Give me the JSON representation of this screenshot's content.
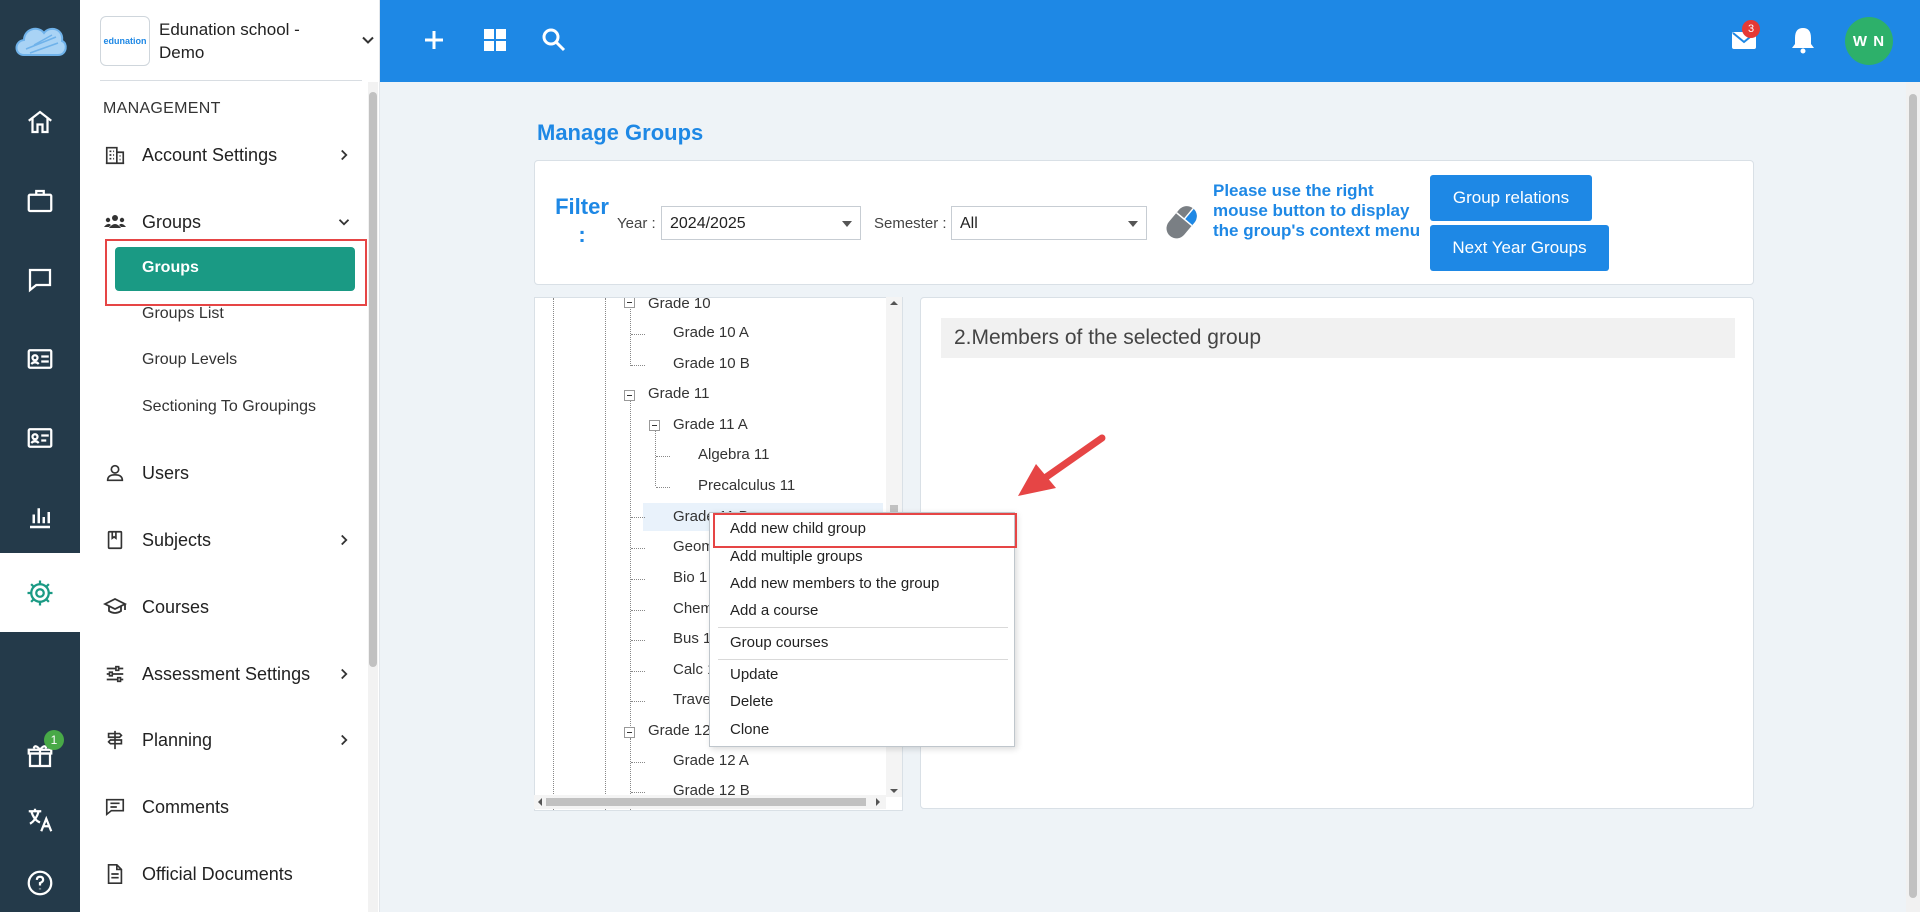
{
  "rail": {
    "items": [
      "home-icon",
      "briefcase-icon",
      "chat-icon",
      "id-card-icon",
      "profile-card-icon",
      "bar-chart-icon",
      "gear-icon",
      "gift-icon",
      "translate-icon",
      "help-icon"
    ],
    "gift_badge": "1",
    "active_color": "#1a9a84"
  },
  "school": {
    "logo_text": "edunation",
    "name": "Edunation school - Demo"
  },
  "menu": {
    "section": "MANAGEMENT",
    "account_settings": "Account Settings",
    "groups": "Groups",
    "groups_sub": [
      "Groups",
      "Groups List",
      "Group Levels",
      "Sectioning To Groupings"
    ],
    "users": "Users",
    "subjects": "Subjects",
    "courses": "Courses",
    "assessment_settings": "Assessment Settings",
    "planning": "Planning",
    "comments": "Comments",
    "official_documents": "Official Documents"
  },
  "topbar": {
    "color": "#1e88e5",
    "mail_badge": "3",
    "avatar": "W N"
  },
  "page": {
    "title": "Manage Groups",
    "filter_label": "Filter :",
    "year_label": "Year :",
    "year_value": "2024/2025",
    "semester_label": "Semester :",
    "semester_value": "All",
    "hint": "Please use the right mouse button to display the group's context menu",
    "btn_relations": "Group relations",
    "btn_next_year": "Next Year Groups"
  },
  "tree": {
    "nodes": [
      "Grade 10",
      "Grade 10 A",
      "Grade 10 B",
      "Grade 11",
      "Grade 11 A",
      "Algebra 11",
      "Precalculus 11",
      "Grade 11 B",
      "Geom",
      "Bio 1",
      "Chem",
      "Bus 1",
      "Calc 1",
      "Trave",
      "Grade 12",
      "Grade 12 A",
      "Grade 12 B"
    ]
  },
  "members": {
    "title": "2.Members of the selected group"
  },
  "context_menu": {
    "items": [
      "Add new child group",
      "Add multiple groups",
      "Add new members to the group",
      "Add a course",
      "Group courses",
      "Update",
      "Delete",
      "Clone"
    ]
  }
}
